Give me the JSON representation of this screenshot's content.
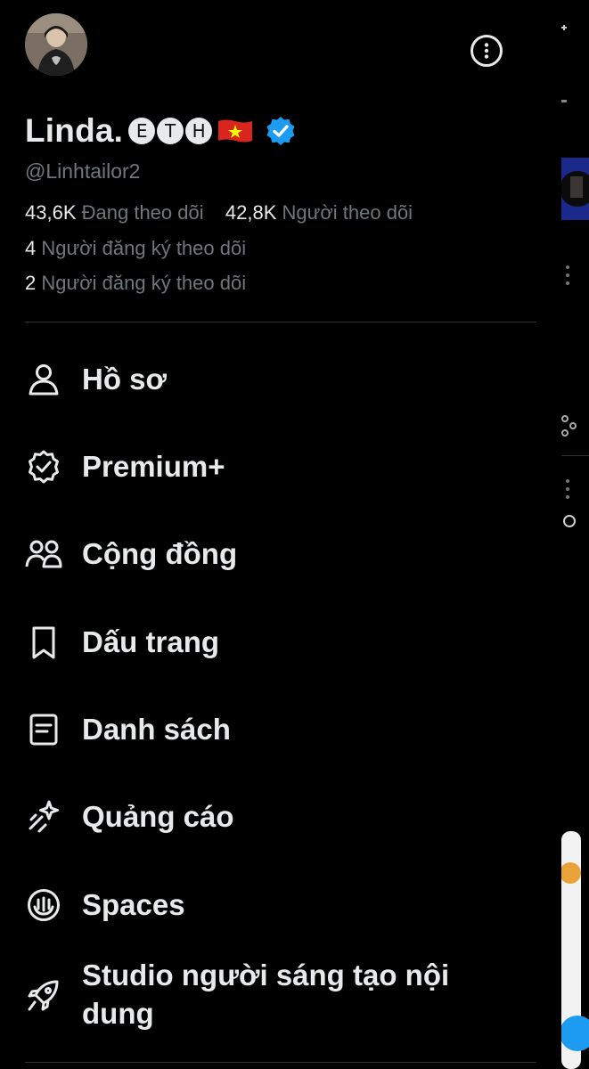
{
  "profile": {
    "display_name": "Linda.",
    "name_badges": [
      "E",
      "T",
      "H"
    ],
    "handle": "@Linhtailor2",
    "following_count": "43,6K",
    "following_label": "Đang theo dõi",
    "followers_count": "42,8K",
    "followers_label": "Người theo dõi",
    "subscriptions": [
      {
        "count": "4",
        "label": "Người đăng ký theo dõi"
      },
      {
        "count": "2",
        "label": "Người đăng ký theo dõi"
      }
    ]
  },
  "menu": {
    "items": [
      {
        "label": "Hồ sơ",
        "icon": "person-icon"
      },
      {
        "label": "Premium+",
        "icon": "premium-badge-icon"
      },
      {
        "label": "Cộng đồng",
        "icon": "communities-icon"
      },
      {
        "label": "Dấu trang",
        "icon": "bookmark-icon"
      },
      {
        "label": "Danh sách",
        "icon": "list-icon"
      },
      {
        "label": "Quảng cáo",
        "icon": "ads-sparkle-icon"
      },
      {
        "label": "Spaces",
        "icon": "spaces-mic-icon"
      },
      {
        "label": "Studio người sáng tạo nội dung",
        "icon": "rocket-icon"
      }
    ]
  },
  "colors": {
    "background": "#000000",
    "primary_text": "#e7e9ea",
    "secondary_text": "#71767b",
    "divider": "#2f3336",
    "verified_blue": "#1d9bf0",
    "flag_red": "#da251d",
    "flag_star": "#ffff00"
  }
}
